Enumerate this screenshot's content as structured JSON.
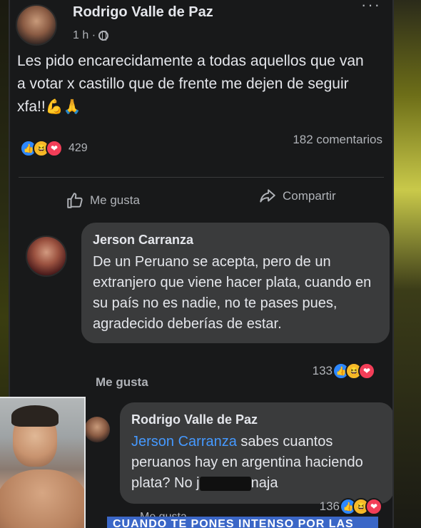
{
  "post": {
    "author": "Rodrigo Valle de Paz",
    "time": "1 h ·",
    "text": "Les pido encarecidamente a todas aquellos que van a votar x castillo que de frente me dejen de seguir xfa!!",
    "emojis": "💪🙏",
    "reactions_count": "429",
    "comments_count": "182 comentarios"
  },
  "actions": {
    "like_label": "Me gusta",
    "share_label": "Compartir"
  },
  "comments": [
    {
      "author": "Jerson Carranza",
      "text": "De un Peruano se acepta, pero de un extranjero que viene hacer plata, cuando en su país no es nadie, no te pases pues, agradecido deberías de estar.",
      "reactions_count": "133",
      "like_label": "Me gusta"
    },
    {
      "author": "Rodrigo Valle de Paz",
      "mention": "Jerson Carranza",
      "text_after_mention": " sabes cuantos peruanos hay en argentina haciendo plata? No j",
      "text_end": "naja",
      "reactions_count": "136",
      "like_label": "Me gusta"
    }
  ],
  "caption": "CUANDO TE PONES INTENSO POR LAS",
  "icons": {
    "like": "like-reaction-icon",
    "haha": "haha-reaction-icon",
    "love": "love-reaction-icon"
  },
  "colors": {
    "background": "#18191a",
    "bubble": "#3a3b3c",
    "text": "#e4e6eb",
    "muted": "#b0b3b8",
    "mention": "#4599ff",
    "like_blue": "#2d88ff",
    "love_red": "#f33e58",
    "haha_yellow": "#f7b928",
    "caption_bg": "#3b67c7"
  }
}
